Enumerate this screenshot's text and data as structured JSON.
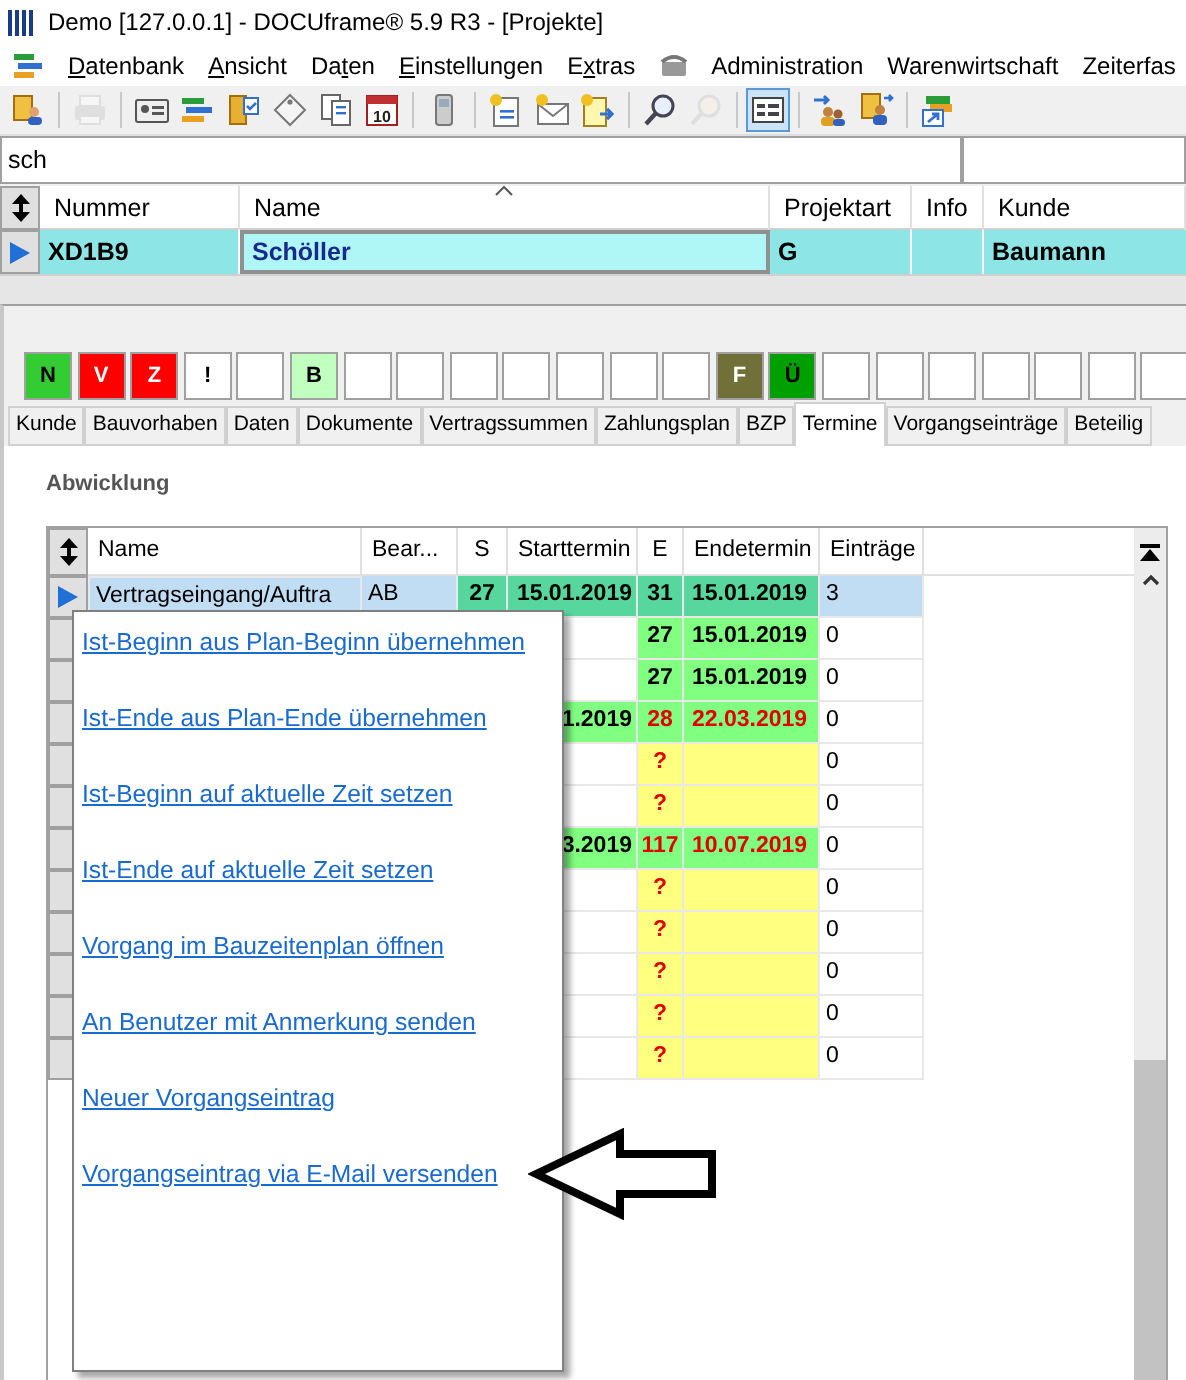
{
  "window": {
    "title": "Demo [127.0.0.1] - DOCUframe® 5.9 R3 - [Projekte]"
  },
  "menu": [
    {
      "kind": "app-icon"
    },
    {
      "kind": "item",
      "key": "D",
      "after": "atenbank"
    },
    {
      "kind": "item",
      "key": "A",
      "after": "nsicht"
    },
    {
      "kind": "item",
      "before": "Da",
      "key": "t",
      "after": "en"
    },
    {
      "kind": "item",
      "key": "E",
      "after": "instellungen"
    },
    {
      "kind": "item",
      "before": "E",
      "key": "x",
      "after": "tras"
    },
    {
      "kind": "icon"
    },
    {
      "kind": "item",
      "before": "Administration"
    },
    {
      "kind": "item",
      "before": "Warenwirtschaft"
    },
    {
      "kind": "item",
      "before": "Zeiterfas"
    }
  ],
  "toolbar": [
    {
      "kind": "people",
      "disabled": false,
      "pressed": false
    },
    {
      "kind": "separator"
    },
    {
      "kind": "printer",
      "disabled": true,
      "pressed": false
    },
    {
      "kind": "separator"
    },
    {
      "kind": "id-card",
      "disabled": false,
      "pressed": false
    },
    {
      "kind": "stack",
      "disabled": false,
      "pressed": false
    },
    {
      "kind": "folder",
      "disabled": false,
      "pressed": false
    },
    {
      "kind": "tag",
      "disabled": false,
      "pressed": false
    },
    {
      "kind": "documents",
      "disabled": false,
      "pressed": false
    },
    {
      "kind": "calendar",
      "label": "10",
      "disabled": false,
      "pressed": false
    },
    {
      "kind": "separator"
    },
    {
      "kind": "phone",
      "disabled": false,
      "pressed": false
    },
    {
      "kind": "separator"
    },
    {
      "kind": "new-document",
      "disabled": false,
      "pressed": false
    },
    {
      "kind": "new-envelope",
      "disabled": false,
      "pressed": false
    },
    {
      "kind": "document-arrow",
      "disabled": false,
      "pressed": false
    },
    {
      "kind": "separator"
    },
    {
      "kind": "search",
      "disabled": false,
      "pressed": false
    },
    {
      "kind": "search",
      "disabled": true,
      "pressed": false
    },
    {
      "kind": "separator"
    },
    {
      "kind": "form",
      "disabled": false,
      "pressed": true
    },
    {
      "kind": "separator"
    },
    {
      "kind": "people-arrow",
      "disabled": false,
      "pressed": false
    },
    {
      "kind": "people-document",
      "disabled": false,
      "pressed": false
    },
    {
      "kind": "separator"
    },
    {
      "kind": "window-arrow",
      "disabled": false,
      "pressed": false
    }
  ],
  "search": {
    "value": "sch"
  },
  "projects": {
    "columns": [
      {
        "label": "Nummer",
        "sorted": false
      },
      {
        "label": "Name",
        "sorted": true
      },
      {
        "label": "Projektart",
        "sorted": false
      },
      {
        "label": "Info",
        "sorted": false
      },
      {
        "label": "Kunde",
        "sorted": false
      }
    ],
    "rows": [
      {
        "selected": true,
        "nummer": "XD1B9",
        "name": "Schöller",
        "projektart": "G",
        "kunde": "Baumann"
      }
    ]
  },
  "flags": [
    {
      "label": "N",
      "color": "#33cc33"
    },
    {
      "label": "V",
      "color": "#ff0000"
    },
    {
      "label": "Z",
      "color": "#ff0000"
    },
    {
      "label": "!",
      "color": "#ffffff"
    },
    {
      "color": "#ffffff"
    },
    {
      "label": "B",
      "color": "#c0ffc0"
    },
    {
      "color": "#ffffff"
    },
    {
      "color": "#ffffff"
    },
    {
      "color": "#ffffff"
    },
    {
      "color": "#ffffff"
    },
    {
      "color": "#ffffff"
    },
    {
      "color": "#ffffff"
    },
    {
      "color": "#ffffff"
    },
    {
      "label": "F",
      "color": "#707038"
    },
    {
      "label": "Ü",
      "color": "#00a000"
    },
    {
      "color": "#ffffff"
    },
    {
      "color": "#ffffff"
    },
    {
      "color": "#ffffff"
    },
    {
      "color": "#ffffff"
    },
    {
      "color": "#ffffff"
    },
    {
      "color": "#ffffff"
    },
    {
      "color": "#ffffff"
    }
  ],
  "tabs": [
    {
      "label": "Kunde",
      "selected": false
    },
    {
      "label": "Bauvorhaben",
      "selected": false
    },
    {
      "label": "Daten",
      "selected": false
    },
    {
      "label": "Dokumente",
      "selected": false
    },
    {
      "label": "Vertragssummen",
      "selected": false
    },
    {
      "label": "Zahlungsplan",
      "selected": false
    },
    {
      "label": "BZP",
      "selected": false
    },
    {
      "label": "Termine",
      "selected": true
    },
    {
      "label": "Vorgangseinträge",
      "selected": false
    },
    {
      "label": "Beteilig",
      "selected": false
    }
  ],
  "section": {
    "title": "Abwicklung"
  },
  "schedule": {
    "columns": [
      "Name",
      "Bear...",
      "S",
      "Starttermin",
      "E",
      "Endetermin",
      "Einträge"
    ],
    "rows": [
      {
        "selected": true,
        "kind": "done",
        "name": "Vertragseingang/Auftra",
        "bearbeiter": "AB",
        "s": "27",
        "start": "15.01.2019",
        "e": "31",
        "end": "15.01.2019",
        "entries": "3"
      },
      {
        "selected": false,
        "kind": "ok",
        "e": "27",
        "end": "15.01.2019",
        "entries": "0"
      },
      {
        "selected": false,
        "kind": "ok",
        "e": "27",
        "end": "15.01.2019",
        "entries": "0"
      },
      {
        "selected": false,
        "kind": "late",
        "start": "1.2019",
        "e": "28",
        "end": "22.03.2019",
        "entries": "0"
      },
      {
        "selected": false,
        "kind": "open",
        "e": "?",
        "entries": "0"
      },
      {
        "selected": false,
        "kind": "open",
        "e": "?",
        "entries": "0"
      },
      {
        "selected": false,
        "kind": "late",
        "start": "3.2019",
        "e": "117",
        "end": "10.07.2019",
        "entries": "0"
      },
      {
        "selected": false,
        "kind": "open",
        "e": "?",
        "entries": "0"
      },
      {
        "selected": false,
        "kind": "open",
        "e": "?",
        "entries": "0"
      },
      {
        "selected": false,
        "kind": "open",
        "e": "?",
        "entries": "0"
      },
      {
        "selected": false,
        "kind": "open",
        "e": "?",
        "entries": "0"
      },
      {
        "selected": false,
        "kind": "open",
        "e": "?",
        "entries": "0"
      }
    ]
  },
  "context_menu": {
    "items": [
      "Ist-Beginn aus Plan-Beginn übernehmen",
      "Ist-Ende aus Plan-Ende übernehmen",
      "Ist-Beginn auf aktuelle Zeit setzen",
      "Ist-Ende auf aktuelle Zeit setzen",
      "Vorgang im Bauzeitenplan öffnen",
      "An Benutzer mit Anmerkung senden",
      "Neuer Vorgangseintrag",
      "Vorgangseintrag via E-Mail versenden"
    ]
  }
}
